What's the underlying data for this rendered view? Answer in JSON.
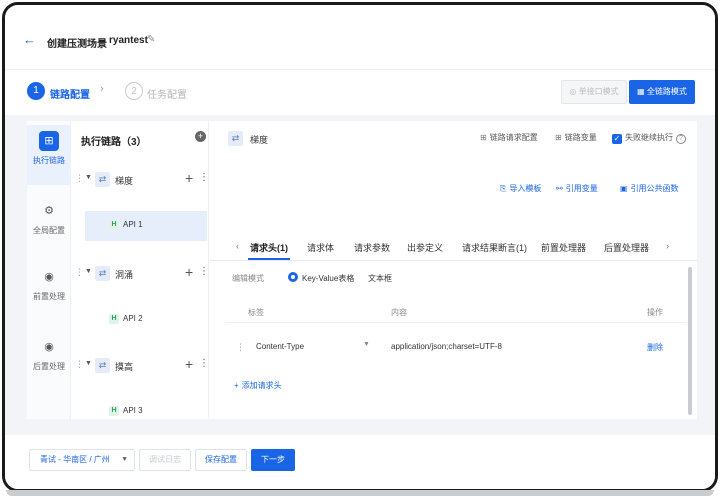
{
  "header": {
    "back_icon": "arrow-left-icon",
    "title": "创建压测场景",
    "scene_name": "ryantest",
    "edit_icon": "pencil-icon"
  },
  "steps": [
    {
      "number": "1",
      "label": "链路配置",
      "active": true
    },
    {
      "number": "2",
      "label": "任务配置",
      "active": false
    }
  ],
  "mode_buttons": {
    "single_api": "单接口模式",
    "full_chain": "全链路模式"
  },
  "left_nav": [
    {
      "label": "执行链路",
      "icon": "flow-icon",
      "active": true
    },
    {
      "label": "全局配置",
      "icon": "settings-icon",
      "active": false
    },
    {
      "label": "前置处理",
      "icon": "pre-process-icon",
      "active": false
    },
    {
      "label": "后置处理",
      "icon": "post-process-icon",
      "active": false
    }
  ],
  "tree": {
    "title": "执行链路（3）",
    "groups": [
      {
        "label": "梯度",
        "api": "API 1",
        "selected": true
      },
      {
        "label": "洞涌",
        "api": "API 2",
        "selected": false
      },
      {
        "label": "摸高",
        "api": "API 3",
        "selected": false
      }
    ]
  },
  "content": {
    "title": "梯度",
    "top_actions": {
      "chain_config": "链路请求配置",
      "chain_vars": "链路变量",
      "continue_on_fail": "失败继续执行"
    },
    "links": {
      "import_template": "导入模板",
      "ref_variable": "引用变量",
      "ref_function": "引用公共函数"
    },
    "tabs": [
      "请求头(1)",
      "请求体",
      "请求参数",
      "出参定义",
      "请求结果断言(1)",
      "前置处理器",
      "后置处理器"
    ],
    "edit_mode_label": "编辑模式",
    "edit_mode_options": [
      "Key-Value表格",
      "文本框"
    ],
    "table": {
      "columns": [
        "标签",
        "内容",
        "操作"
      ],
      "rows": [
        {
          "key": "Content-Type",
          "value": "application/json;charset=UTF-8",
          "action": "删除"
        }
      ]
    },
    "add_header": "添加请求头"
  },
  "bottom": {
    "region": "青试 - 华南区 / 广州",
    "debug": "调试日志",
    "save": "保存配置",
    "next": "下一步"
  },
  "colors": {
    "primary": "#1a64e6",
    "api_badge": "#2f9e5c"
  }
}
